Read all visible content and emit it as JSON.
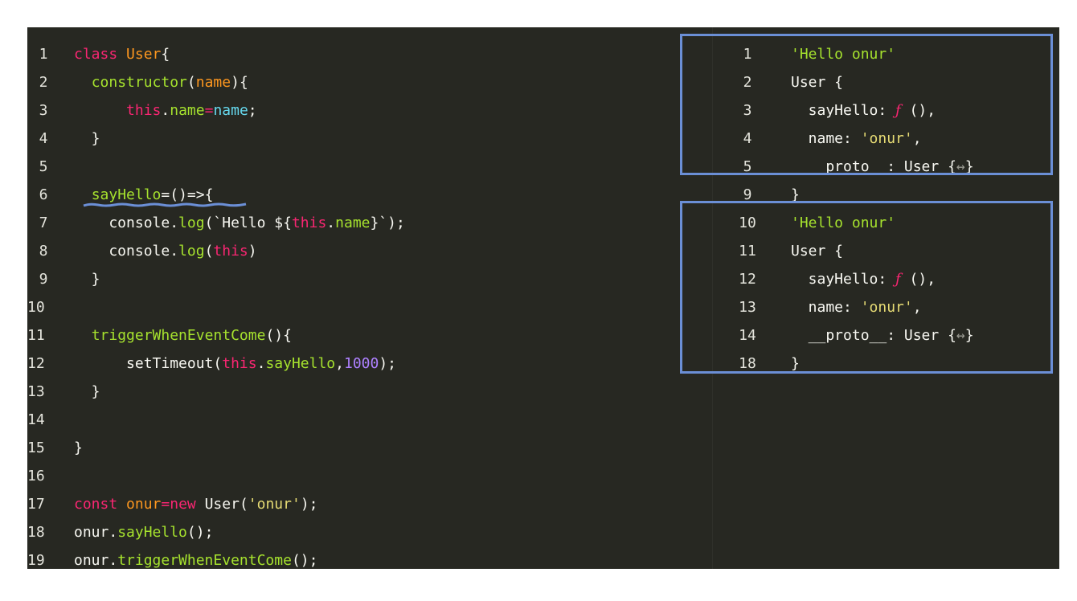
{
  "code": {
    "lines": [
      {
        "n": "1",
        "segments": [
          {
            "t": "class ",
            "c": "kw"
          },
          {
            "t": "User",
            "c": "cls"
          },
          {
            "t": "{",
            "c": ""
          }
        ]
      },
      {
        "n": "2",
        "segments": [
          {
            "t": "  ",
            "c": ""
          },
          {
            "t": "constructor",
            "c": "fn"
          },
          {
            "t": "(",
            "c": ""
          },
          {
            "t": "name",
            "c": "cls"
          },
          {
            "t": "){",
            "c": ""
          }
        ]
      },
      {
        "n": "3",
        "segments": [
          {
            "t": "      ",
            "c": ""
          },
          {
            "t": "this",
            "c": "kw"
          },
          {
            "t": ".",
            "c": ""
          },
          {
            "t": "name",
            "c": "fn"
          },
          {
            "t": "=",
            "c": "kw"
          },
          {
            "t": "name",
            "c": "prop"
          },
          {
            "t": ";",
            "c": ""
          }
        ]
      },
      {
        "n": "4",
        "segments": [
          {
            "t": "  }",
            "c": ""
          }
        ]
      },
      {
        "n": "5",
        "segments": []
      },
      {
        "n": "6",
        "segments": [
          {
            "t": "  ",
            "c": ""
          },
          {
            "t": "sayHello",
            "c": "fn"
          },
          {
            "t": "=()=>{",
            "c": ""
          }
        ]
      },
      {
        "n": "7",
        "segments": [
          {
            "t": "    console.",
            "c": ""
          },
          {
            "t": "log",
            "c": "fn"
          },
          {
            "t": "(`Hello ${",
            "c": ""
          },
          {
            "t": "this",
            "c": "kw"
          },
          {
            "t": ".",
            "c": ""
          },
          {
            "t": "name",
            "c": "fn"
          },
          {
            "t": "}`);",
            "c": ""
          }
        ]
      },
      {
        "n": "8",
        "segments": [
          {
            "t": "    console.",
            "c": ""
          },
          {
            "t": "log",
            "c": "fn"
          },
          {
            "t": "(",
            "c": ""
          },
          {
            "t": "this",
            "c": "kw"
          },
          {
            "t": ")",
            "c": ""
          }
        ]
      },
      {
        "n": "9",
        "segments": [
          {
            "t": "  }",
            "c": ""
          }
        ]
      },
      {
        "n": "10",
        "segments": []
      },
      {
        "n": "11",
        "segments": [
          {
            "t": "  ",
            "c": ""
          },
          {
            "t": "triggerWhenEventCome",
            "c": "fn"
          },
          {
            "t": "(){",
            "c": ""
          }
        ]
      },
      {
        "n": "12",
        "segments": [
          {
            "t": "      setTimeout(",
            "c": ""
          },
          {
            "t": "this",
            "c": "kw"
          },
          {
            "t": ".",
            "c": ""
          },
          {
            "t": "sayHello",
            "c": "fn"
          },
          {
            "t": ",",
            "c": ""
          },
          {
            "t": "1000",
            "c": "num"
          },
          {
            "t": ");",
            "c": ""
          }
        ]
      },
      {
        "n": "13",
        "segments": [
          {
            "t": "  }",
            "c": ""
          }
        ]
      },
      {
        "n": "14",
        "segments": []
      },
      {
        "n": "15",
        "segments": [
          {
            "t": "}",
            "c": ""
          }
        ]
      },
      {
        "n": "16",
        "segments": []
      },
      {
        "n": "17",
        "segments": [
          {
            "t": "const ",
            "c": "kw"
          },
          {
            "t": "onur",
            "c": "cls"
          },
          {
            "t": "=",
            "c": "kw"
          },
          {
            "t": "new ",
            "c": "kw"
          },
          {
            "t": "User(",
            "c": ""
          },
          {
            "t": "'onur'",
            "c": "str"
          },
          {
            "t": ");",
            "c": ""
          }
        ]
      },
      {
        "n": "18",
        "segments": [
          {
            "t": "onur.",
            "c": ""
          },
          {
            "t": "sayHello",
            "c": "fn"
          },
          {
            "t": "();",
            "c": ""
          }
        ]
      },
      {
        "n": "19",
        "segments": [
          {
            "t": "onur.",
            "c": ""
          },
          {
            "t": "triggerWhenEventCome",
            "c": "fn"
          },
          {
            "t": "();",
            "c": ""
          }
        ]
      }
    ]
  },
  "output": {
    "lines": [
      {
        "n": "1",
        "segments": [
          {
            "t": "'Hello onur'",
            "c": "fn"
          }
        ]
      },
      {
        "n": "2",
        "segments": [
          {
            "t": "User {",
            "c": ""
          }
        ]
      },
      {
        "n": "3",
        "segments": [
          {
            "t": "  sayHello: ",
            "c": ""
          },
          {
            "t": "ƒ",
            "c": "fsym"
          },
          {
            "t": " (),",
            "c": ""
          }
        ]
      },
      {
        "n": "4",
        "segments": [
          {
            "t": "  name: ",
            "c": ""
          },
          {
            "t": "'onur'",
            "c": "str"
          },
          {
            "t": ",",
            "c": ""
          }
        ]
      },
      {
        "n": "5",
        "segments": [
          {
            "t": "  __proto__: User {",
            "c": ""
          },
          {
            "t": "↔",
            "c": "dim"
          },
          {
            "t": "}",
            "c": ""
          }
        ]
      },
      {
        "n": "9",
        "segments": [
          {
            "t": "}",
            "c": ""
          }
        ]
      },
      {
        "n": "10",
        "segments": [
          {
            "t": "'Hello onur'",
            "c": "fn"
          }
        ]
      },
      {
        "n": "11",
        "segments": [
          {
            "t": "User {",
            "c": ""
          }
        ]
      },
      {
        "n": "12",
        "segments": [
          {
            "t": "  sayHello: ",
            "c": ""
          },
          {
            "t": "ƒ",
            "c": "fsym"
          },
          {
            "t": " (),",
            "c": ""
          }
        ]
      },
      {
        "n": "13",
        "segments": [
          {
            "t": "  name: ",
            "c": ""
          },
          {
            "t": "'onur'",
            "c": "str"
          },
          {
            "t": ",",
            "c": ""
          }
        ]
      },
      {
        "n": "14",
        "segments": [
          {
            "t": "  __proto__: User {",
            "c": ""
          },
          {
            "t": "↔",
            "c": "dim"
          },
          {
            "t": "}",
            "c": ""
          }
        ]
      },
      {
        "n": "18",
        "segments": [
          {
            "t": "}",
            "c": ""
          }
        ]
      }
    ]
  },
  "colors": {
    "editor_bg": "#272822",
    "keyword": "#f92672",
    "class_name": "#fd971f",
    "function": "#a6e22e",
    "string": "#e6db74",
    "number": "#ae81ff",
    "highlight_box": "#6b8fd6"
  }
}
